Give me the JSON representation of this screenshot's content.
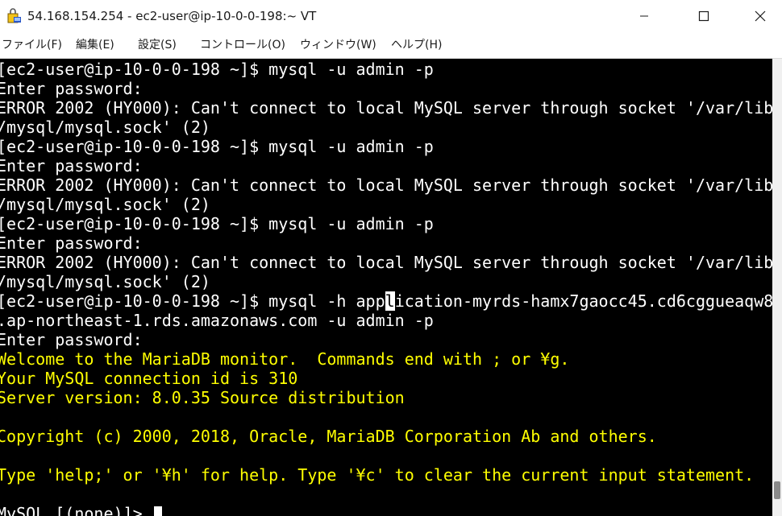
{
  "window": {
    "title": "54.168.154.254 - ec2-user@ip-10-0-0-198:~ VT",
    "icons": {
      "app": "teraterm-icon",
      "minimize": "minimize-icon",
      "maximize": "maximize-icon",
      "close": "close-icon"
    }
  },
  "menu": [
    {
      "label": "ファイル(F)"
    },
    {
      "label": "編集(E)"
    },
    {
      "label": "設定(S)"
    },
    {
      "label": "コントロール(O)"
    },
    {
      "label": "ウィンドウ(W)"
    },
    {
      "label": "ヘルプ(H)"
    }
  ],
  "terminal": {
    "colors": {
      "background": "#000000",
      "text": "#ffffff",
      "highlight": "#ffff00"
    },
    "lines": [
      {
        "text": "[ec2-user@ip-10-0-0-198 ~]$ mysql -u admin -p",
        "color": "white"
      },
      {
        "text": "Enter password:",
        "color": "white"
      },
      {
        "text": "ERROR 2002 (HY000): Can't connect to local MySQL server through socket '/var/lib",
        "color": "white"
      },
      {
        "text": "/mysql/mysql.sock' (2)",
        "color": "white"
      },
      {
        "text": "[ec2-user@ip-10-0-0-198 ~]$ mysql -u admin -p",
        "color": "white"
      },
      {
        "text": "Enter password:",
        "color": "white"
      },
      {
        "text": "ERROR 2002 (HY000): Can't connect to local MySQL server through socket '/var/lib",
        "color": "white"
      },
      {
        "text": "/mysql/mysql.sock' (2)",
        "color": "white"
      },
      {
        "text": "[ec2-user@ip-10-0-0-198 ~]$ mysql -u admin -p",
        "color": "white"
      },
      {
        "text": "Enter password:",
        "color": "white"
      },
      {
        "text": "ERROR 2002 (HY000): Can't connect to local MySQL server through socket '/var/lib",
        "color": "white"
      },
      {
        "text": "/mysql/mysql.sock' (2)",
        "color": "white"
      },
      {
        "text_before": "[ec2-user@ip-10-0-0-198 ~]$ mysql -h app",
        "text_cursor": "l",
        "text_after": "ication-myrds-hamx7gaocc45.cd6cggueaqw8",
        "color": "white",
        "has_cursor": true
      },
      {
        "text": ".ap-northeast-1.rds.amazonaws.com -u admin -p",
        "color": "white"
      },
      {
        "text": "Enter password:",
        "color": "white"
      },
      {
        "text": "Welcome to the MariaDB monitor.  Commands end with ; or ¥g.",
        "color": "yellow"
      },
      {
        "text": "Your MySQL connection id is 310",
        "color": "yellow"
      },
      {
        "text": "Server version: 8.0.35 Source distribution",
        "color": "yellow"
      },
      {
        "text": "",
        "color": "yellow"
      },
      {
        "text": "Copyright (c) 2000, 2018, Oracle, MariaDB Corporation Ab and others.",
        "color": "yellow"
      },
      {
        "text": "",
        "color": "yellow"
      },
      {
        "text": "Type 'help;' or '¥h' for help. Type '¥c' to clear the current input statement.",
        "color": "yellow"
      },
      {
        "text": "",
        "color": "white"
      },
      {
        "text": "MySQL [(none)]> ",
        "color": "white",
        "block_cursor": true
      }
    ]
  }
}
